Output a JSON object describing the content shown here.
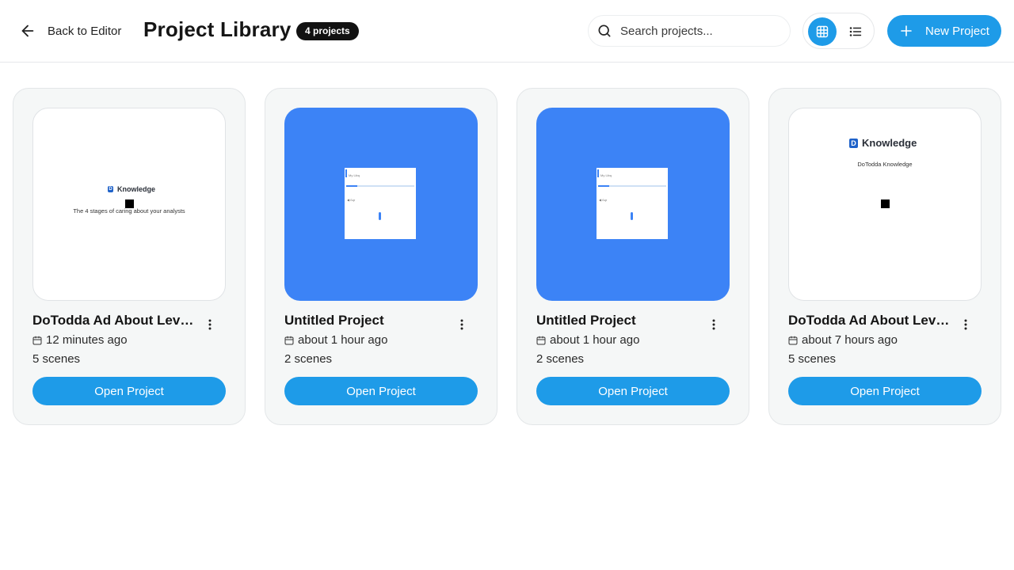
{
  "header": {
    "back_label": "Back to Editor",
    "title": "Project Library",
    "count_badge": "4 projects",
    "search_placeholder": "Search projects...",
    "new_project_label": "New Project",
    "view_modes": [
      "grid",
      "list"
    ],
    "active_view": "grid"
  },
  "colors": {
    "accent": "#1e9be8",
    "thumb_blue": "#3c83f6",
    "badge_bg": "#121212"
  },
  "projects": [
    {
      "name": "DoTodda Ad About Level...",
      "time": "12 minutes ago",
      "scenes": "5 scenes",
      "open_label": "Open Project",
      "thumb": {
        "logo_text": "Knowledge",
        "subtitle": "The 4 stages of caring about your analysts"
      }
    },
    {
      "name": "Untitled Project",
      "time": "about 1 hour ago",
      "scenes": "2 scenes",
      "open_label": "Open Project",
      "thumb": {
        "mini_title": "My Libq",
        "mini_label": "◀ ßqr"
      }
    },
    {
      "name": "Untitled Project",
      "time": "about 1 hour ago",
      "scenes": "2 scenes",
      "open_label": "Open Project",
      "thumb": {
        "mini_title": "My Libq",
        "mini_label": "◀ ßqr"
      }
    },
    {
      "name": "DoTodda Ad About Level...",
      "time": "about 7 hours ago",
      "scenes": "5 scenes",
      "open_label": "Open Project",
      "thumb": {
        "logo_text": "Knowledge",
        "subtitle": "DoTodda Knowledge"
      }
    }
  ]
}
